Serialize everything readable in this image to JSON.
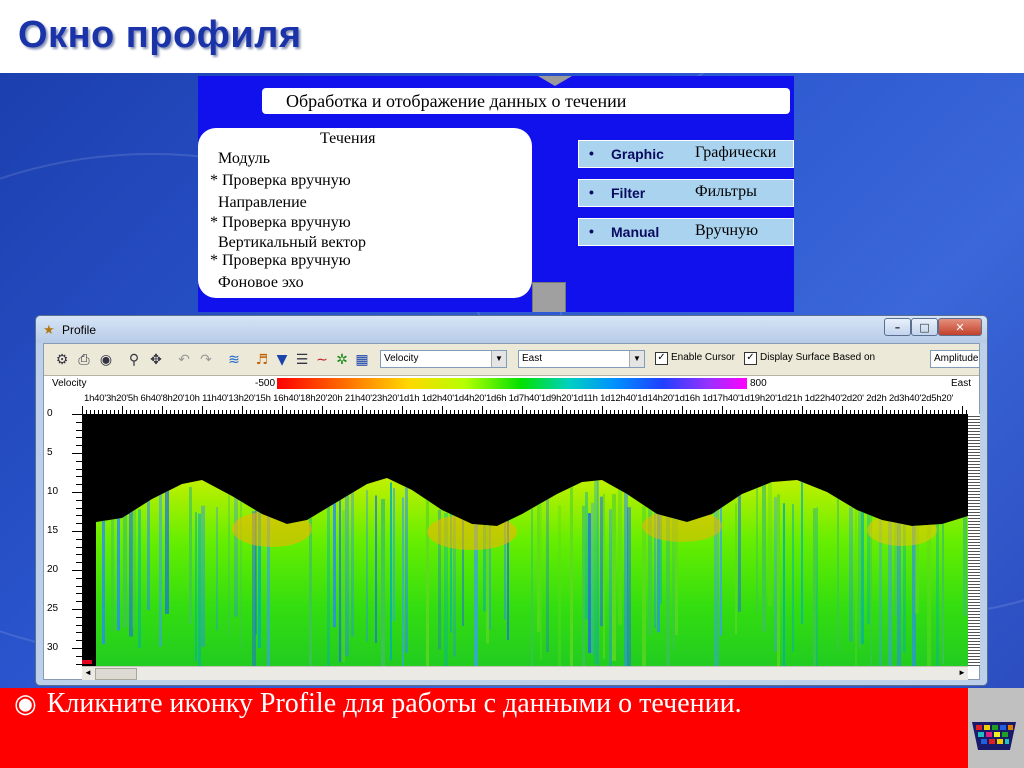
{
  "slide": {
    "title": "Окно профиля",
    "caption": "Кликните иконку Profile для работы с данными о течении.",
    "bullet_icon": "circle-dot-icon",
    "logo_icon": "grid-basket-logo-icon"
  },
  "diagram": {
    "header": "Обработка и отображение данных о течении",
    "box_lines": [
      "Течения",
      "Модуль",
      "* Проверка вручную",
      "Направление",
      "* Проверка вручную",
      "Вертикальный вектор",
      "* Проверка вручную",
      "Фоновое эхо"
    ],
    "buttons": [
      {
        "en": "Graphic",
        "ru": "Графически"
      },
      {
        "en": "Filter",
        "ru": "Фильтры"
      },
      {
        "en": "Manual",
        "ru": "Вручную"
      }
    ],
    "bullet": "•"
  },
  "window": {
    "title": "Profile",
    "controls": {
      "minimize": "–",
      "maximize": "□",
      "close": "✕"
    },
    "toolbar": {
      "icons": [
        "wrench-icon",
        "printer-icon",
        "camera-icon",
        "zoom-icon",
        "fit-icon",
        "undo-icon",
        "redo-icon",
        "wave-icon",
        "person-icon",
        "funnel-icon",
        "notes-icon",
        "line-chart-icon",
        "compass-icon",
        "grid-icon"
      ],
      "parameter_select": "Velocity",
      "component_select": "East",
      "enable_cursor_label": "Enable Cursor",
      "enable_cursor_checked": true,
      "display_surface_label": "Display Surface Based on",
      "display_surface_checked": true,
      "display_surface_value": "Amplitude"
    },
    "scale": {
      "parameter": "Velocity",
      "min": "-500",
      "max": "800",
      "component": "East"
    },
    "time_labels": "1h40'3h20'5h   6h40'8h20'10h   11h40'13h20'15h   16h40'18h20'20h   21h40'23h20'1d1h 1d2h40'1d4h20'1d6h 1d7h40'1d9h20'1d11h 1d12h40'1d14h20'1d16h 1d17h40'1d19h20'1d21h 1d22h40'2d20' 2d2h 2d3h40'2d5h20'",
    "depth_labels": [
      "0",
      "5",
      "10",
      "15",
      "20",
      "25",
      "30"
    ],
    "scroll": {
      "left": "◄",
      "right": "►"
    },
    "colors": {
      "surface_mask": "#000000",
      "marker": "#e0001a"
    }
  }
}
